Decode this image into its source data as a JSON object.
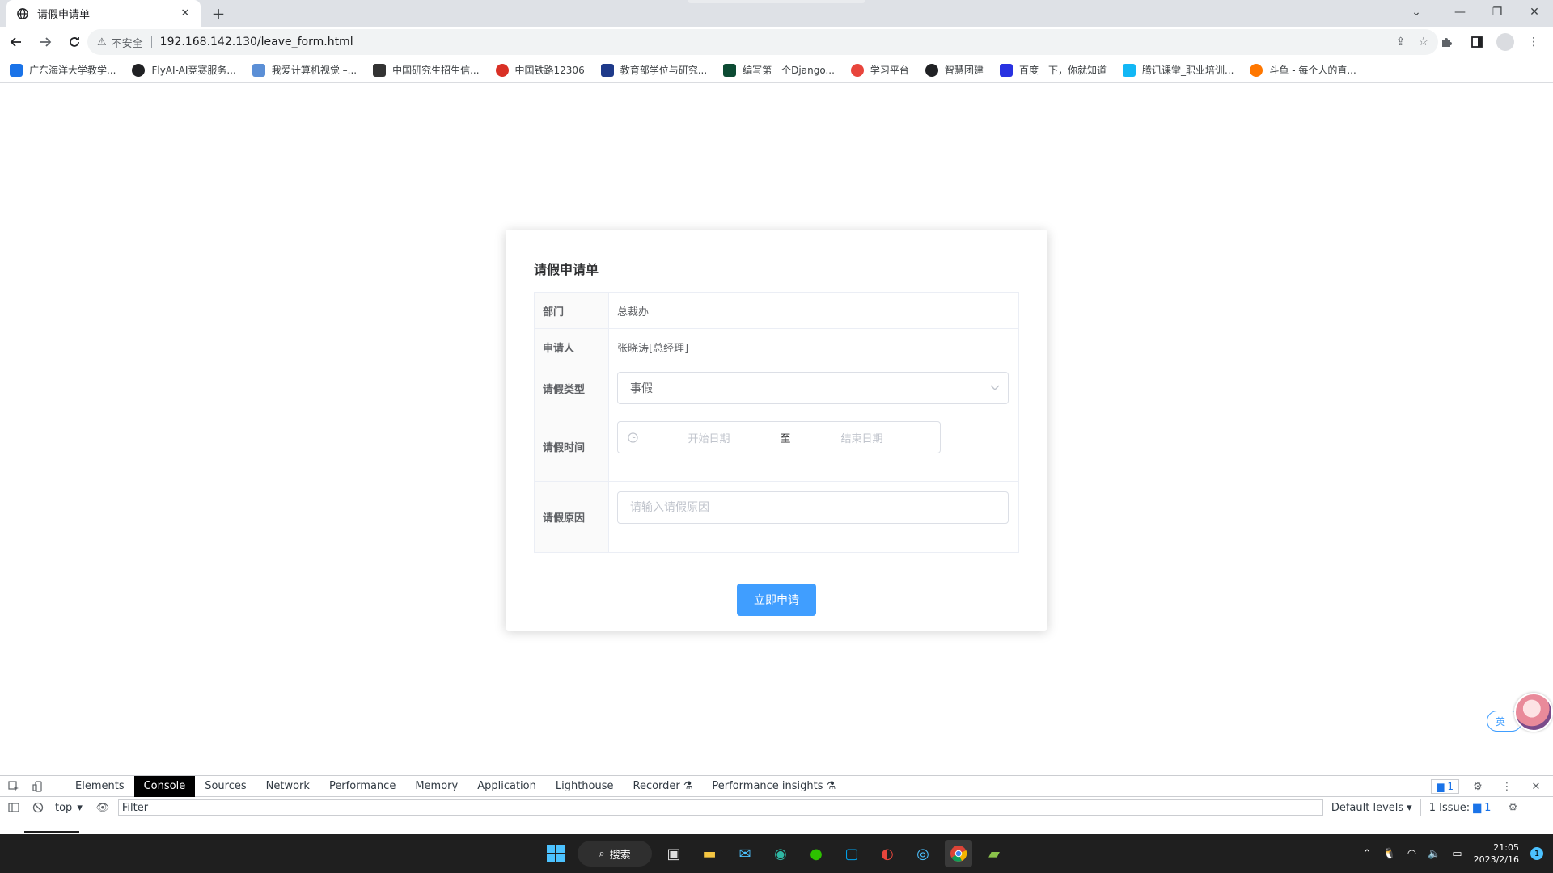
{
  "browser": {
    "tab_title": "请假申请单",
    "security_label": "不安全",
    "url": "192.168.142.130/leave_form.html",
    "bookmarks": [
      {
        "label": "广东海洋大学教学...",
        "color": "#1a73e8"
      },
      {
        "label": "FlyAI-AI竞赛服务...",
        "color": "#202124"
      },
      {
        "label": "我爱计算机视觉 –...",
        "color": "#5b8fd6"
      },
      {
        "label": "中国研究生招生信...",
        "color": "#333333"
      },
      {
        "label": "中国铁路12306",
        "color": "#d93025"
      },
      {
        "label": "教育部学位与研究...",
        "color": "#1e3a8a"
      },
      {
        "label": "编写第一个Django...",
        "color": "#0c4b33"
      },
      {
        "label": "学习平台",
        "color": "#e8453c"
      },
      {
        "label": "智慧团建",
        "color": "#202124"
      },
      {
        "label": "百度一下，你就知道",
        "color": "#2932e1"
      },
      {
        "label": "腾讯课堂_职业培训...",
        "color": "#12b7f5"
      },
      {
        "label": "斗鱼 - 每个人的直...",
        "color": "#ff7700"
      }
    ]
  },
  "form": {
    "title": "请假申请单",
    "department_label": "部门",
    "department_value": "总裁办",
    "applicant_label": "申请人",
    "applicant_value": "张晓涛[总经理]",
    "leave_type_label": "请假类型",
    "leave_type_value": "事假",
    "leave_time_label": "请假时间",
    "start_placeholder": "开始日期",
    "range_separator": "至",
    "end_placeholder": "结束日期",
    "reason_label": "请假原因",
    "reason_placeholder": "请输入请假原因",
    "submit_label": "立即申请",
    "accent_color": "#409eff"
  },
  "assistant": {
    "lang_label": "英"
  },
  "devtools": {
    "tabs": [
      "Elements",
      "Console",
      "Sources",
      "Network",
      "Performance",
      "Memory",
      "Application",
      "Lighthouse",
      "Recorder",
      "Performance insights"
    ],
    "active_tab": "Console",
    "message_count": "1",
    "context": "top",
    "filter_placeholder": "Filter",
    "levels": "Default levels",
    "issues_label": "1 Issue:",
    "issues_count": "1"
  },
  "taskbar": {
    "search_label": "搜索",
    "time": "21:05",
    "date": "2023/2/16",
    "notification_count": "1"
  }
}
